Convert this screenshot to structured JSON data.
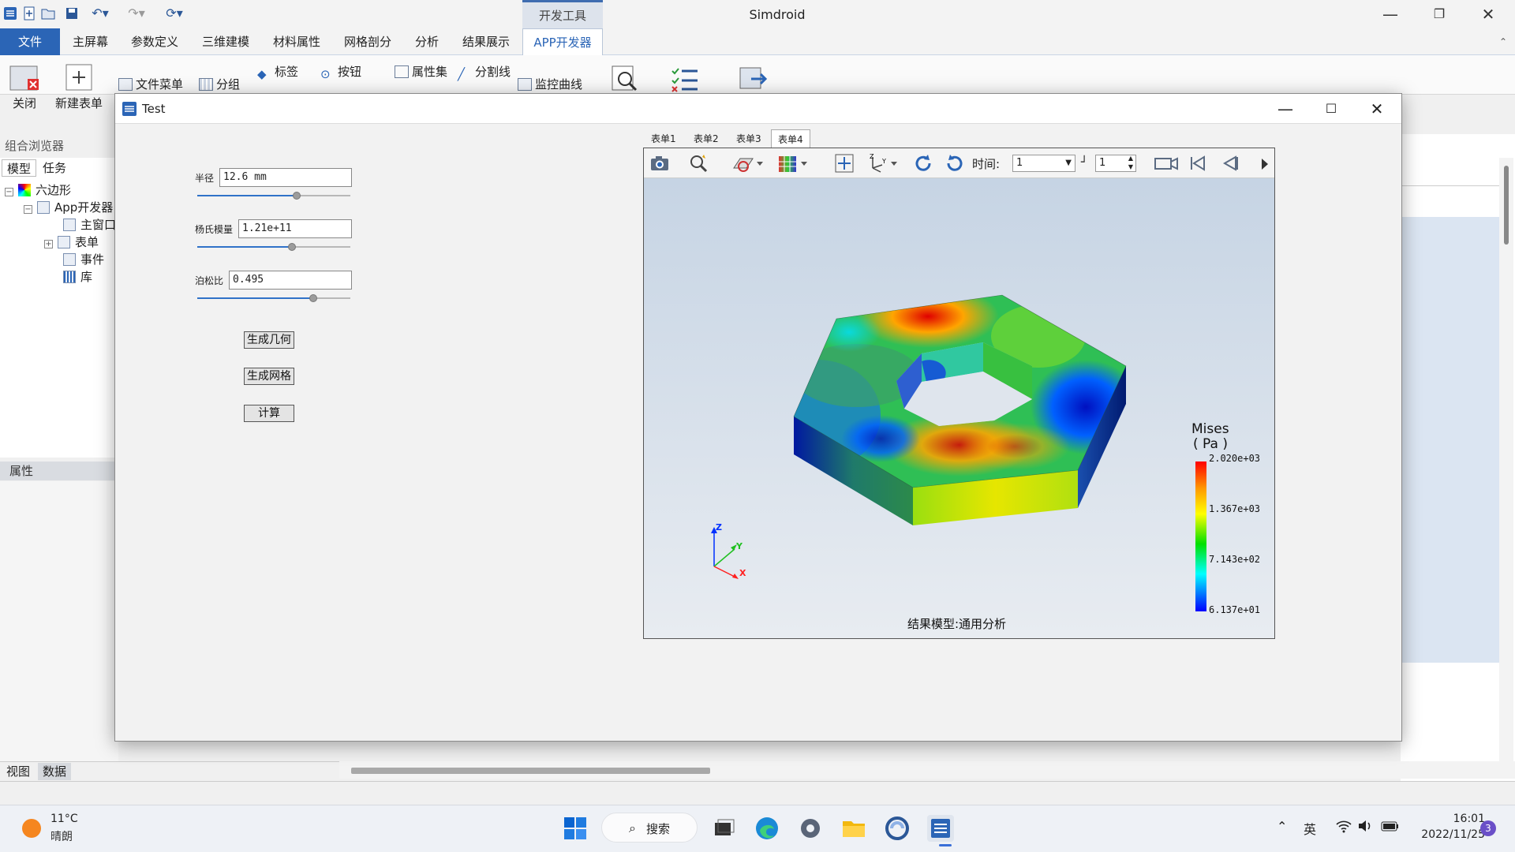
{
  "app": {
    "title": "Simdroid",
    "devtools_tab": "开发工具",
    "menu": [
      "文件",
      "主屏幕",
      "参数定义",
      "三维建模",
      "材料属性",
      "网格剖分",
      "分析",
      "结果展示",
      "APP开发器"
    ]
  },
  "ribbon": {
    "close": "关闭",
    "new_form": "新建表单",
    "file_menu": "文件菜单",
    "group": "分组",
    "label": "标签",
    "button": "按钮",
    "property_set": "属性集",
    "divider": "分割线",
    "monitor_curve": "监控曲线"
  },
  "left_panel": {
    "header": "组合浏览器",
    "tabs": [
      "模型",
      "任务"
    ],
    "tree": {
      "root": "六边形",
      "app": "App开发器",
      "main_window": "主窗口",
      "forms": "表单",
      "events": "事件",
      "library": "库"
    },
    "properties": "属性",
    "bottom_tabs": [
      "视图",
      "数据"
    ]
  },
  "dialog": {
    "title": "Test",
    "radius_label": "半径",
    "radius_value": "12.6 mm",
    "radius_level": 0.65,
    "youngs_label": "杨氏模量",
    "youngs_value": "1.21e+11",
    "youngs_level": 0.62,
    "poisson_label": "泊松比",
    "poisson_value": "0.495",
    "poisson_level": 0.76,
    "btn_geometry": "生成几何",
    "btn_mesh": "生成网格",
    "btn_compute": "计算",
    "tabs": [
      "表单1",
      "表单2",
      "表单3",
      "表单4"
    ],
    "active_tab": "表单4",
    "viewer": {
      "time_label": "时间:",
      "time_value": "1",
      "step_value": "1",
      "legend_title": "Mises",
      "legend_unit": "( Pa )",
      "legend_ticks": [
        "2.020e+03",
        "1.367e+03",
        "7.143e+02",
        "6.137e+01"
      ],
      "model_label": "结果模型:通用分析",
      "axis_labels": {
        "z": "Z",
        "y": "Y",
        "x": "X"
      }
    }
  },
  "taskbar": {
    "temperature": "11°C",
    "weather": "晴朗",
    "search": "搜索",
    "ime": "英",
    "time": "16:01",
    "date": "2022/11/25",
    "notifications": "3"
  },
  "colors": {
    "accent": "#2b65b6",
    "legend_high": "#ff0000",
    "legend_low": "#0000ff"
  }
}
